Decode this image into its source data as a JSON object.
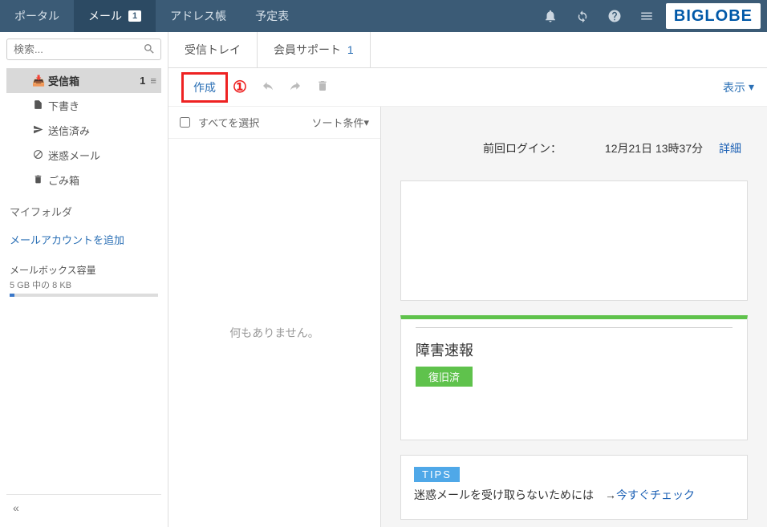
{
  "topnav": {
    "tabs": [
      {
        "label": "ポータル"
      },
      {
        "label": "メール",
        "badge": "1"
      },
      {
        "label": "アドレス帳"
      },
      {
        "label": "予定表"
      }
    ],
    "logo": "BIGLOBE"
  },
  "search": {
    "placeholder": "検索..."
  },
  "folders": {
    "inbox": {
      "label": "受信箱",
      "count": "1"
    },
    "drafts": {
      "label": "下書き"
    },
    "sent": {
      "label": "送信済み"
    },
    "spam": {
      "label": "迷惑メール"
    },
    "trash": {
      "label": "ごみ箱"
    },
    "myfolder_label": "マイフォルダ",
    "add_account": "メールアカウントを追加"
  },
  "quota": {
    "title": "メールボックス容量",
    "text": "5 GB 中の 8 KB"
  },
  "content_tabs": {
    "inbox": "受信トレイ",
    "support": "会員サポート",
    "support_count": "1"
  },
  "toolbar": {
    "compose": "作成",
    "annotation_num": "①",
    "view": "表示"
  },
  "listheader": {
    "select_all": "すべてを選択",
    "sort": "ソート条件"
  },
  "empty_text": "何もありません。",
  "preview": {
    "login_label": "前回ログイン：",
    "login_time": "12月21日 13時37分",
    "detail": "詳細",
    "incident_title": "障害速報",
    "incident_status": "復旧済",
    "tips_badge": "TIPS",
    "tips_text": "迷惑メールを受け取らないためには　→",
    "tips_link": "今すぐチェック"
  }
}
